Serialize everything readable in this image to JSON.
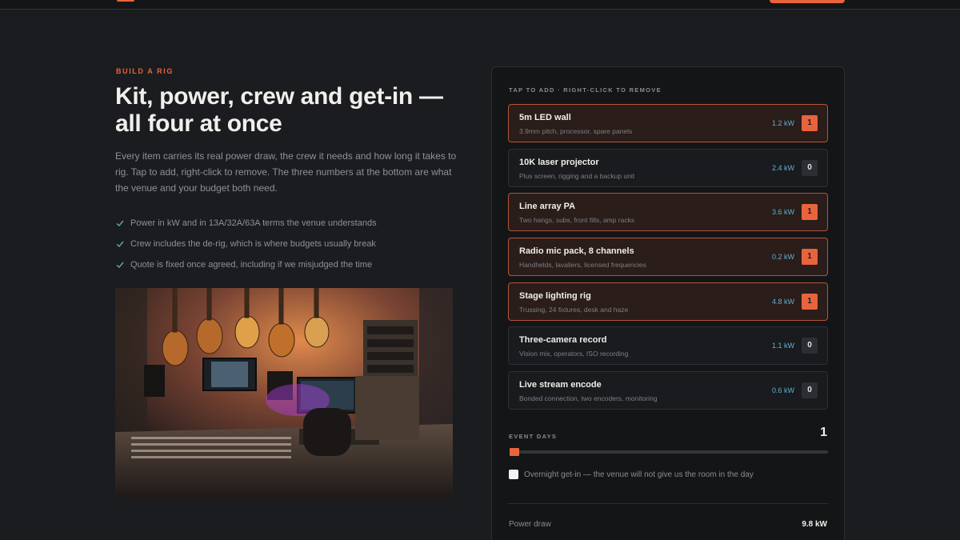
{
  "hero": {
    "eyebrow": "BUILD A RIG",
    "title": "Kit, power, crew and get-in — all four at once",
    "lede": "Every item carries its real power draw, the crew it needs and how long it takes to rig. Tap to add, right-click to remove. The three numbers at the bottom are what the venue and your budget both need.",
    "checks": [
      "Power in kW and in 13A/32A/63A terms the venue understands",
      "Crew includes the de-rig, which is where budgets usually break",
      "Quote is fixed once agreed, including if we misjudged the time"
    ]
  },
  "builder": {
    "hint": "TAP TO ADD · RIGHT-CLICK TO REMOVE",
    "items": [
      {
        "title": "5m LED wall",
        "sub": "3.9mm pitch, processor, spare panels",
        "kw": "1.2 kW",
        "count": "1",
        "selected": true
      },
      {
        "title": "10K laser projector",
        "sub": "Plus screen, rigging and a backup unit",
        "kw": "2.4 kW",
        "count": "0",
        "selected": false
      },
      {
        "title": "Line array PA",
        "sub": "Two hangs, subs, front fills, amp racks",
        "kw": "3.6 kW",
        "count": "1",
        "selected": true
      },
      {
        "title": "Radio mic pack, 8 channels",
        "sub": "Handhelds, lavaliers, licensed frequencies",
        "kw": "0.2 kW",
        "count": "1",
        "selected": true
      },
      {
        "title": "Stage lighting rig",
        "sub": "Trussing, 24 fixtures, desk and haze",
        "kw": "4.8 kW",
        "count": "1",
        "selected": true
      },
      {
        "title": "Three-camera record",
        "sub": "Vision mix, operators, ISO recording",
        "kw": "1.1 kW",
        "count": "0",
        "selected": false
      },
      {
        "title": "Live stream encode",
        "sub": "Bonded connection, two encoders, monitoring",
        "kw": "0.6 kW",
        "count": "0",
        "selected": false
      }
    ],
    "days_label": "EVENT DAYS",
    "days_value": "1",
    "overnight_label": "Overnight get-in — the venue will not give us the room in the day",
    "summary": {
      "label": "Power draw",
      "value": "9.8 kW"
    }
  },
  "colors": {
    "accent": "#e8643c",
    "kw": "#5fb0d6",
    "check": "#5fae9a",
    "bg": "#1b1c1f"
  },
  "icons": [
    "check-icon"
  ]
}
